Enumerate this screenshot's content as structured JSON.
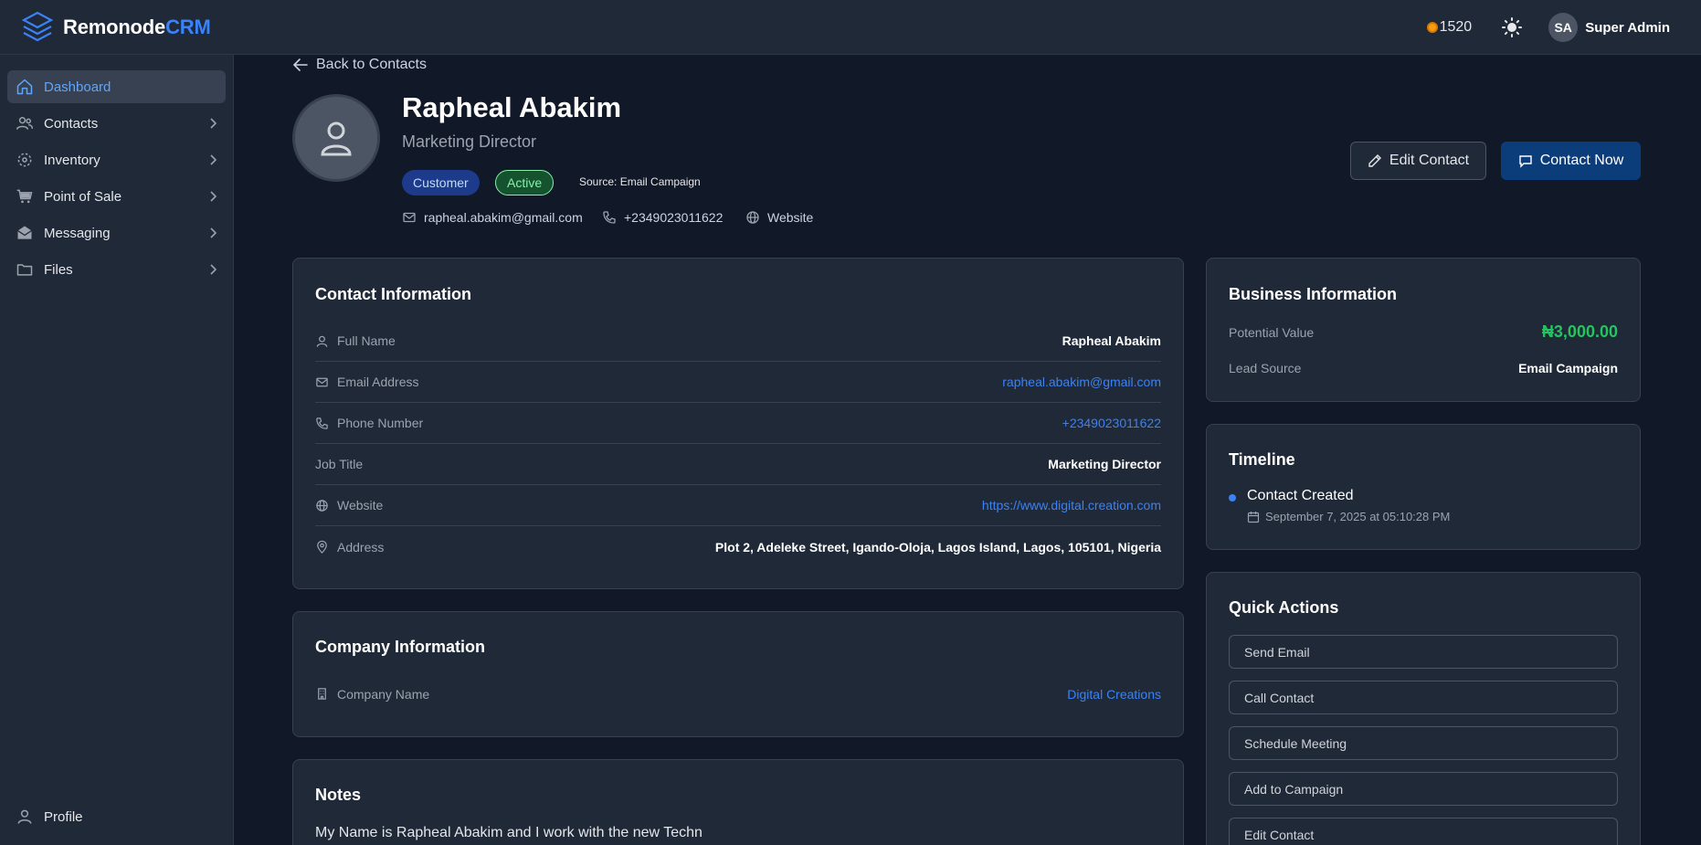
{
  "brand": {
    "name_main": "Remonode",
    "name_accent": "CRM"
  },
  "header": {
    "credits": "1520",
    "user_initials": "SA",
    "user_name": "Super Admin"
  },
  "sidebar": {
    "items": [
      {
        "label": "Dashboard",
        "icon": "home-icon",
        "active": true
      },
      {
        "label": "Contacts",
        "icon": "users-icon"
      },
      {
        "label": "Inventory",
        "icon": "package-icon"
      },
      {
        "label": "Point of Sale",
        "icon": "cart-icon"
      },
      {
        "label": "Messaging",
        "icon": "mail-icon"
      },
      {
        "label": "Files",
        "icon": "folder-icon"
      }
    ],
    "profile_label": "Profile"
  },
  "back_link": "Back to Contacts",
  "contact": {
    "name": "Rapheal Abakim",
    "role": "Marketing Director",
    "badges": {
      "type": "Customer",
      "status": "Active"
    },
    "source": "Source: Email Campaign",
    "email": "rapheal.abakim@gmail.com",
    "phone": "+2349023011622",
    "website_label": "Website"
  },
  "actions": {
    "edit": "Edit Contact",
    "contact_now": "Contact Now"
  },
  "contact_info": {
    "title": "Contact Information",
    "rows": [
      {
        "label": "Full Name",
        "value": "Rapheal Abakim"
      },
      {
        "label": "Email Address",
        "value": "rapheal.abakim@gmail.com"
      },
      {
        "label": "Phone Number",
        "value": "+2349023011622"
      },
      {
        "label": "Job Title",
        "value": "Marketing Director"
      },
      {
        "label": "Website",
        "value": "https://www.digital.creation.com"
      },
      {
        "label": "Address",
        "value": "Plot 2, Adeleke Street, Igando-Oloja, Lagos Island, Lagos, 105101, Nigeria"
      }
    ]
  },
  "company_info": {
    "title": "Company Information",
    "label": "Company Name",
    "value": "Digital Creations"
  },
  "notes": {
    "title": "Notes",
    "text": "My Name is Rapheal Abakim and I work with the new Techn"
  },
  "business_info": {
    "title": "Business Information",
    "potential_label": "Potential Value",
    "potential_value": "₦3,000.00",
    "lead_label": "Lead Source",
    "lead_value": "Email Campaign"
  },
  "timeline": {
    "title": "Timeline",
    "event": "Contact Created",
    "date": "September 7, 2025 at 05:10:28 PM"
  },
  "quick_actions": {
    "title": "Quick Actions",
    "items": [
      "Send Email",
      "Call Contact",
      "Schedule Meeting",
      "Add to Campaign",
      "Edit Contact"
    ]
  },
  "colors": {
    "accent": "#3b82f6",
    "success": "#22c55e",
    "background": "#111827",
    "surface": "#1f2937"
  }
}
